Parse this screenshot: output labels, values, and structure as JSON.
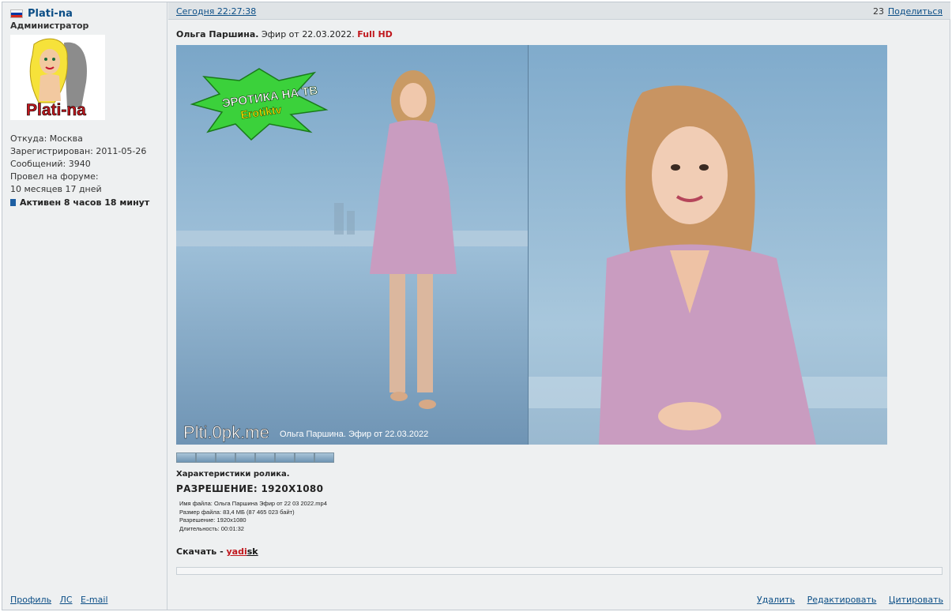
{
  "user": {
    "name": "Plati-na",
    "rank": "Администратор",
    "flag_colors": [
      "#ffffff",
      "#0039a6",
      "#d52b1e"
    ],
    "avatar_caption": "Plati-na",
    "info": [
      "Откуда: Москва",
      "Зарегистрирован: 2011-05-26",
      "Сообщений: 3940",
      "Провел на форуме:",
      "10 месяцев 17 дней"
    ],
    "active": "Активен 8 часов 18 минут",
    "footer_links": [
      "Профиль",
      "ЛС",
      "E-mail"
    ]
  },
  "post": {
    "time": "Сегодня 22:27:38",
    "number": "23",
    "share": "Поделиться",
    "title_name": "Ольга Паршина.",
    "title_rest": " Эфир от 22.03.2022. ",
    "title_hd": "Full HD",
    "poster_logo": "ЭРОТИКА НА ТВ",
    "poster_logo_sub": "Erotiktv",
    "poster_watermark": "Plti.0pk.me",
    "poster_caption": "Ольга Паршина. Эфир от 22.03.2022",
    "thumb_count": 8,
    "specs_head": "Характеристики ролика.",
    "resolution": "РАЗРЕШЕНИЕ: 1920X1080",
    "meta": [
      "Имя файла: Ольга Паршина Эфир от 22 03 2022.mp4",
      "Размер файла: 83,4 МБ (87 465 023 байт)",
      "Разрешение: 1920x1080",
      "Длительность: 00:01:32"
    ],
    "download_label": "Скачать - ",
    "download_link_a": "yadi",
    "download_link_b": "sk",
    "actions": [
      "Удалить",
      "Редактировать",
      "Цитировать"
    ]
  }
}
